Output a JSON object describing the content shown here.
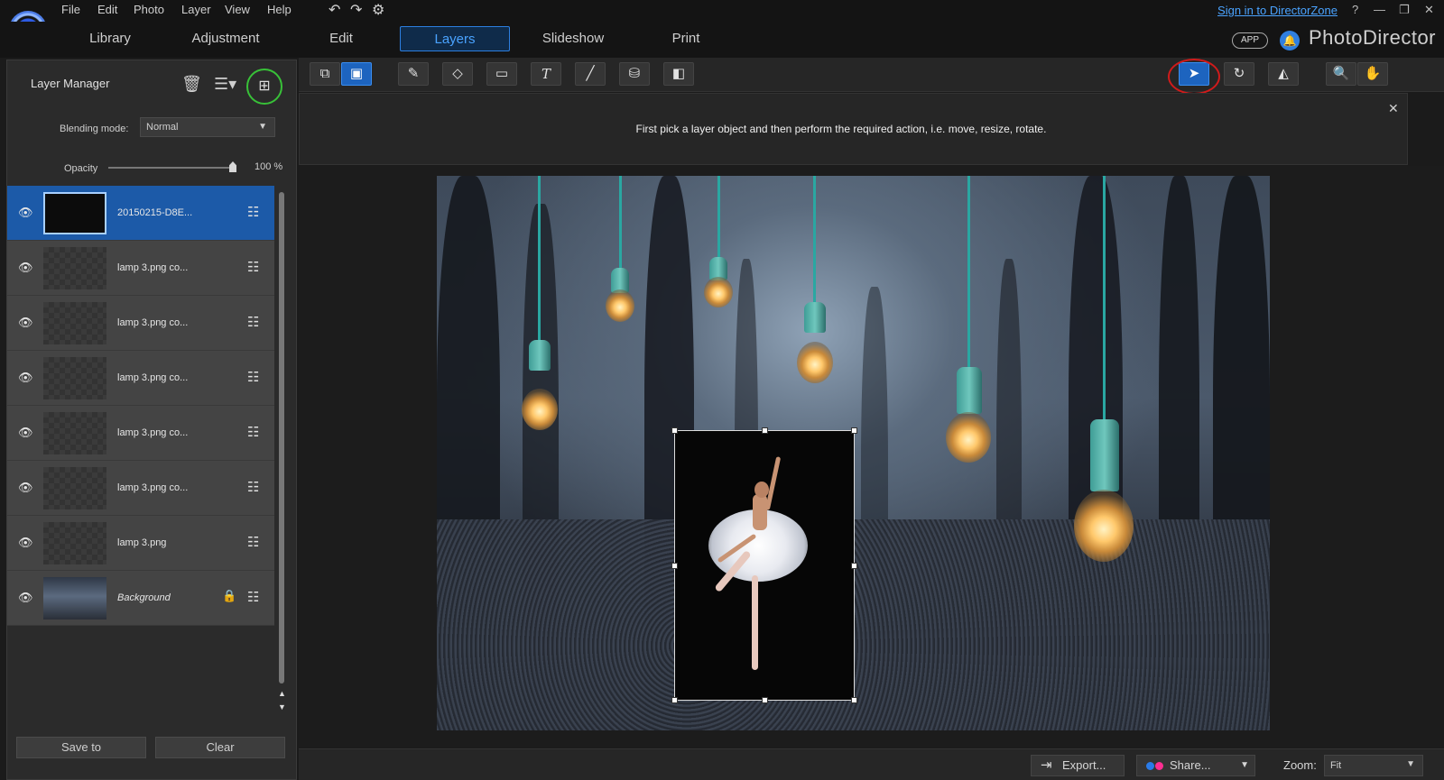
{
  "menu": [
    "File",
    "Edit",
    "Photo",
    "Layer",
    "View",
    "Help"
  ],
  "header": {
    "signin": "Sign in to DirectorZone",
    "help": "?",
    "minimize": "—",
    "restore": "❐",
    "close": "✕",
    "app_badge": "APP",
    "brand": "PhotoDirector"
  },
  "tabs": [
    "Library",
    "Adjustment",
    "Edit",
    "Layers",
    "Slideshow",
    "Print"
  ],
  "active_tab": "Layers",
  "layer_manager": {
    "title": "Layer Manager",
    "blending_label": "Blending mode:",
    "blending_value": "Normal",
    "opacity_label": "Opacity",
    "opacity_value": "100 %",
    "opacity_fraction": 1.0,
    "layers": [
      {
        "name": "20150215-D8E...",
        "selected": true
      },
      {
        "name": "lamp 3.png co...",
        "selected": false
      },
      {
        "name": "lamp 3.png co...",
        "selected": false
      },
      {
        "name": "lamp 3.png co...",
        "selected": false
      },
      {
        "name": "lamp 3.png co...",
        "selected": false
      },
      {
        "name": "lamp 3.png co...",
        "selected": false
      },
      {
        "name": "lamp 3.png",
        "selected": false
      },
      {
        "name": "Background",
        "selected": false,
        "locked": true
      }
    ],
    "save_to": "Save to",
    "clear": "Clear"
  },
  "hint": {
    "text": "First pick a layer object and then perform the required action, i.e. move, resize, rotate."
  },
  "bottom": {
    "export": "Export...",
    "share": "Share...",
    "zoom_label": "Zoom:",
    "zoom_value": "Fit"
  },
  "colors": {
    "accent": "#2c7fe0",
    "highlight_ring_green": "#38c138",
    "highlight_ring_red": "#d01b1b"
  }
}
